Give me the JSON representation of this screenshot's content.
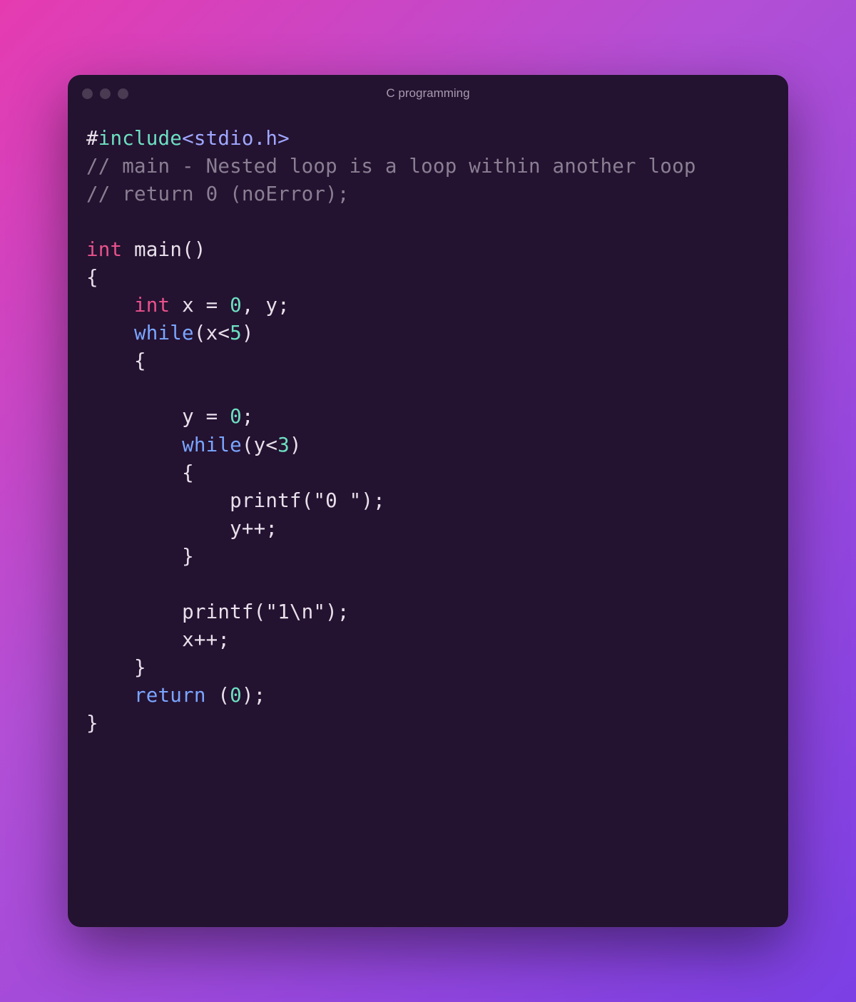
{
  "window": {
    "title": "C programming"
  },
  "code": {
    "l1": {
      "hash": "#",
      "include": "include",
      "header": "<stdio.h>"
    },
    "l2": "// main - Nested loop is a loop within another loop",
    "l3": "// return 0 (noError);",
    "l5": {
      "type": "int",
      "fn": "main",
      "parens": "()"
    },
    "l6": "{",
    "l7": {
      "indent": "    ",
      "type": "int",
      "rest1": " x = ",
      "num": "0",
      "rest2": ", y;"
    },
    "l8": {
      "indent": "    ",
      "kw": "while",
      "open": "(x<",
      "num": "5",
      "close": ")"
    },
    "l9": {
      "indent": "    ",
      "brace": "{"
    },
    "l11": {
      "indent": "        ",
      "expr": "y = ",
      "num": "0",
      "semi": ";"
    },
    "l12": {
      "indent": "        ",
      "kw": "while",
      "open": "(y<",
      "num": "3",
      "close": ")"
    },
    "l13": {
      "indent": "        ",
      "brace": "{"
    },
    "l14": {
      "indent": "            ",
      "fn": "printf",
      "open": "(",
      "str": "\"0 \"",
      "close": ");"
    },
    "l15": {
      "indent": "            ",
      "expr": "y++;"
    },
    "l16": {
      "indent": "        ",
      "brace": "}"
    },
    "l18": {
      "indent": "        ",
      "fn": "printf",
      "open": "(",
      "str": "\"1\\n\"",
      "close": ");"
    },
    "l19": {
      "indent": "        ",
      "expr": "x++;"
    },
    "l20": {
      "indent": "    ",
      "brace": "}"
    },
    "l21": {
      "indent": "    ",
      "kw": "return",
      "open": " (",
      "num": "0",
      "close": ");"
    },
    "l22": "}"
  }
}
